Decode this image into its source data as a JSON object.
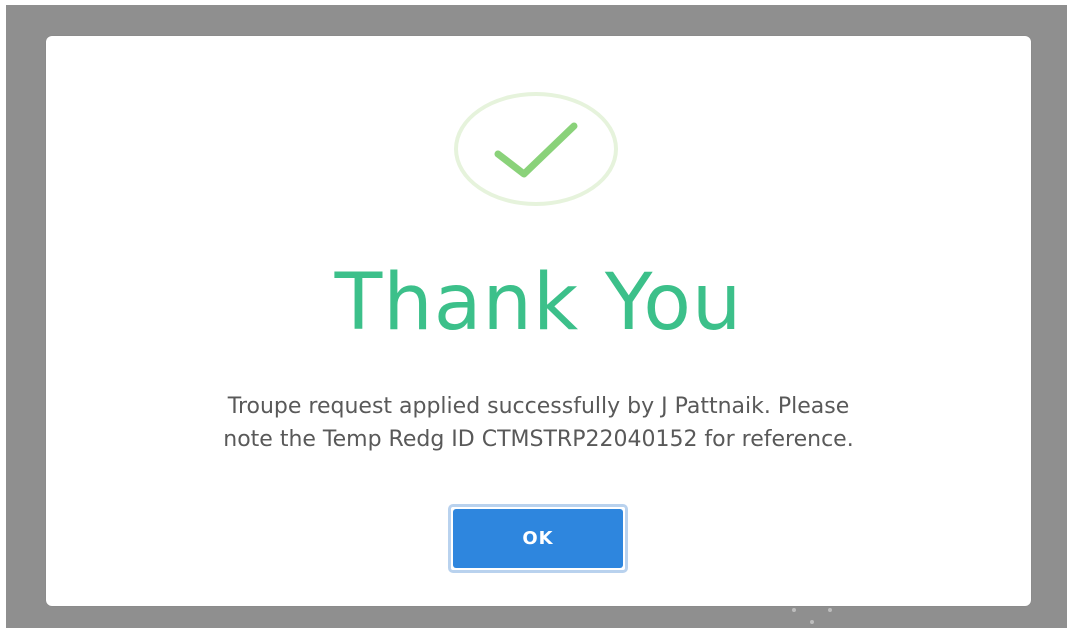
{
  "dialog": {
    "icon": "checkmark-icon",
    "title": "Thank You",
    "message_line1": "Troupe request applied successfully by J Pattnaik. Please",
    "message_line2": "note the Temp Redg ID CTMSTRP22040152 for reference.",
    "ok_label": "OK"
  },
  "colors": {
    "overlay": "#8f8f8f",
    "title": "#3cc08a",
    "check": "#8ad27a",
    "ring": "#e6f3dc",
    "button": "#2e86de",
    "text": "#595959"
  }
}
